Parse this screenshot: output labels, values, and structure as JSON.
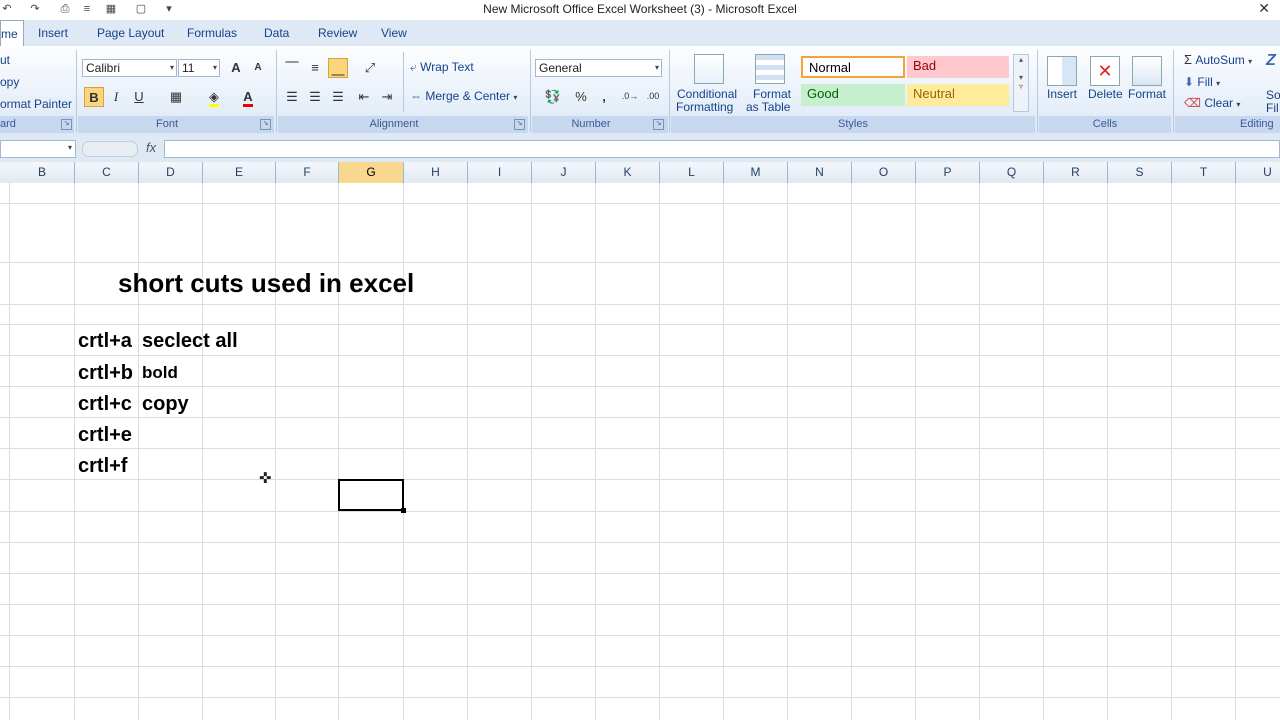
{
  "window": {
    "title": "New Microsoft Office Excel Worksheet (3) - Microsoft Excel",
    "close_glyph": "✕"
  },
  "tabs": [
    {
      "label": "me"
    },
    {
      "label": "Insert"
    },
    {
      "label": "Page Layout"
    },
    {
      "label": "Formulas"
    },
    {
      "label": "Data"
    },
    {
      "label": "Review"
    },
    {
      "label": "View"
    }
  ],
  "clipboard": {
    "cut_label": "ut",
    "copy_label": "opy",
    "format_painter_label": "ormat Painter",
    "group_label": "ard"
  },
  "font": {
    "name": "Calibri",
    "size": "11",
    "group_label": "Font",
    "bold": "B",
    "italic": "I",
    "underline": "U",
    "grow": "A",
    "shrink": "A",
    "font_color": "A"
  },
  "alignment": {
    "wrap_text_label": "Wrap Text",
    "merge_center_label": "Merge & Center",
    "group_label": "Alignment"
  },
  "number": {
    "format": "General",
    "percent": "%",
    "comma": ",",
    "group_label": "Number"
  },
  "styles": {
    "conditional_formatting": [
      "Conditional",
      "Formatting"
    ],
    "format_as_table": [
      "Format",
      "as Table"
    ],
    "normal": "Normal",
    "bad": "Bad",
    "good": "Good",
    "neutral": "Neutral",
    "group_label": "Styles",
    "colors": {
      "normal_border": "#f2a33a",
      "bad_bg": "#ffc7ce",
      "bad_fg": "#9c0006",
      "good_bg": "#c6efce",
      "good_fg": "#006100",
      "neutral_bg": "#ffeb9c",
      "neutral_fg": "#9c6500"
    }
  },
  "cells_group": {
    "insert": "Insert",
    "delete": "Delete",
    "format": "Format",
    "group_label": "Cells"
  },
  "editing": {
    "autosum": "AutoSum",
    "fill": "Fill",
    "clear": "Clear",
    "group_label": "Editing",
    "sort_label": "So",
    "find_label": "Fil"
  },
  "formula_bar": {
    "fx": "fx",
    "namebox_value": ""
  },
  "columns": [
    "B",
    "C",
    "D",
    "E",
    "F",
    "G",
    "H",
    "I",
    "J",
    "K",
    "L",
    "M",
    "N",
    "O",
    "P",
    "Q",
    "R",
    "S",
    "T",
    "U"
  ],
  "selected_column": "G",
  "sheet": {
    "heading": "short cuts used in excel",
    "rows": [
      {
        "key": "crtl+a",
        "desc": "seclect all"
      },
      {
        "key": "crtl+b",
        "desc": "bold"
      },
      {
        "key": "crtl+c",
        "desc": "copy"
      },
      {
        "key": "crtl+e",
        "desc": ""
      },
      {
        "key": "crtl+f",
        "desc": ""
      }
    ]
  },
  "colors": {
    "ribbon_bg": "#dbe7f6",
    "accent": "#15428b",
    "active_col_header": "#f8d88e"
  }
}
